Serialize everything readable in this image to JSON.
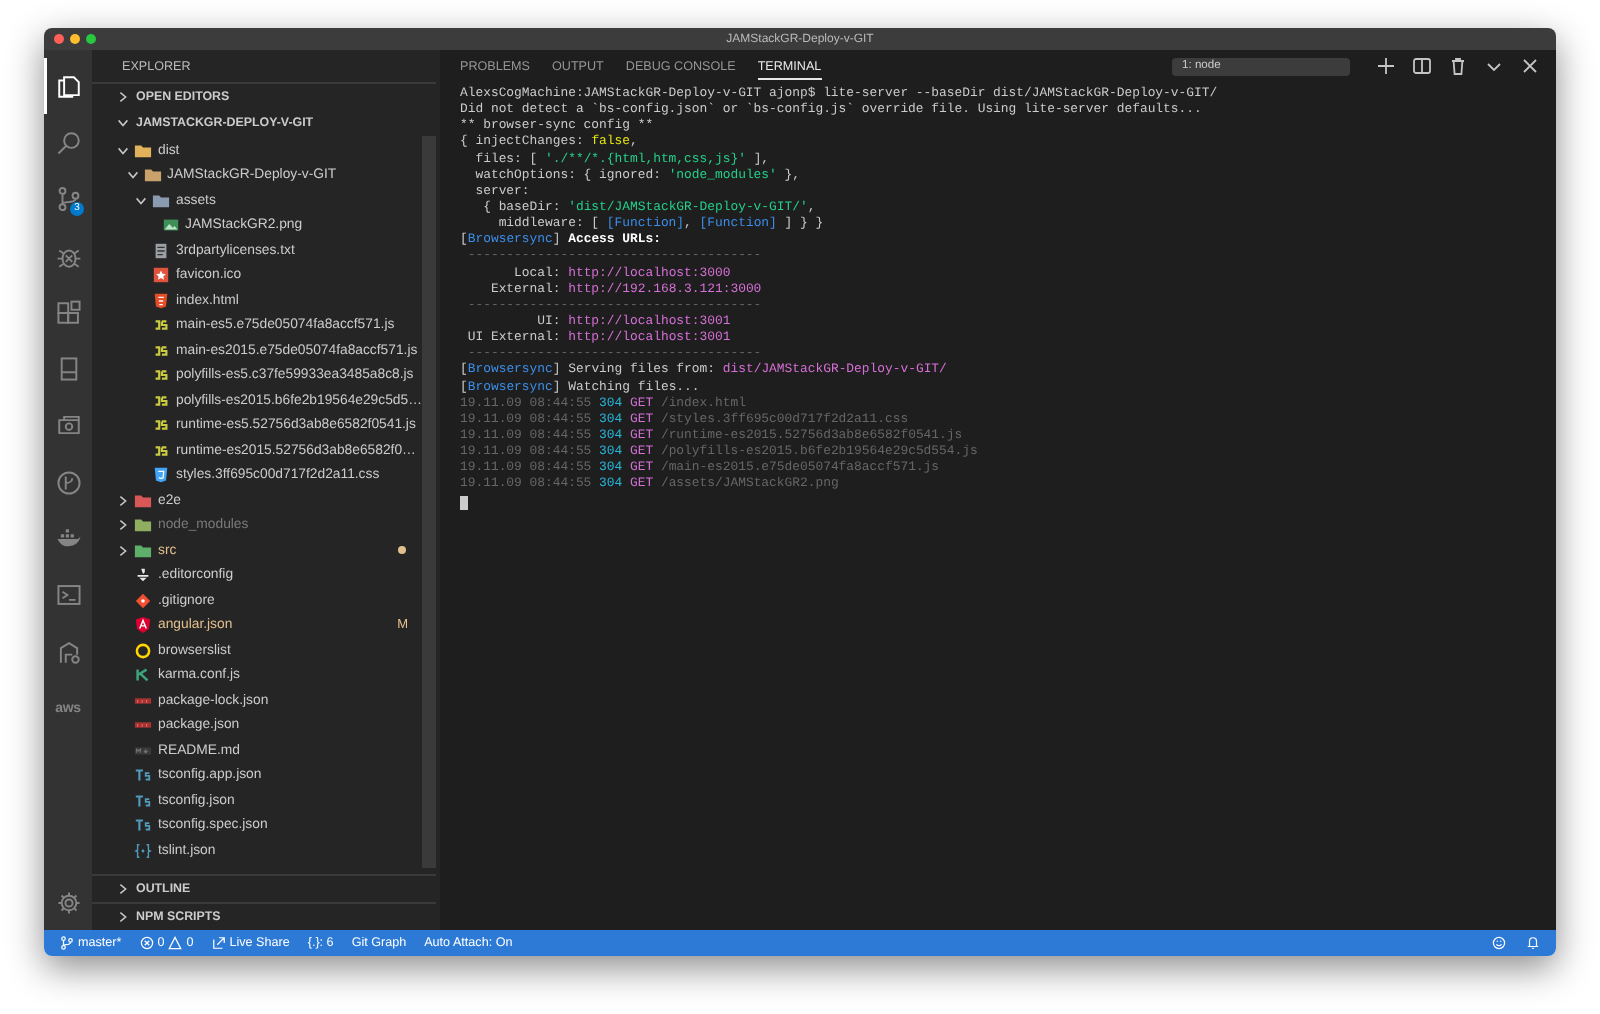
{
  "window": {
    "title": "JAMStackGR-Deploy-v-GIT"
  },
  "activity_bar": {
    "items": [
      {
        "kind": "files",
        "selected": true
      },
      {
        "kind": "search",
        "selected": false
      },
      {
        "kind": "scm",
        "selected": false,
        "badge": "3"
      },
      {
        "kind": "debug",
        "selected": false
      },
      {
        "kind": "extensions",
        "selected": false
      },
      {
        "kind": "book",
        "selected": false
      },
      {
        "kind": "remote",
        "selected": false
      },
      {
        "kind": "gitgraph",
        "selected": false
      },
      {
        "kind": "docker",
        "selected": false
      },
      {
        "kind": "terminal",
        "selected": false
      },
      {
        "kind": "azure",
        "selected": false
      },
      {
        "kind": "aws",
        "selected": false,
        "label": "aws"
      }
    ]
  },
  "sidebar": {
    "title": "EXPLORER",
    "sections": [
      {
        "label": "OPEN EDITORS",
        "expanded": false
      },
      {
        "label": "JAMSTACKGR-DEPLOY-V-GIT",
        "expanded": true
      }
    ],
    "tree": [
      {
        "name": "dist",
        "kind": "folder-dist",
        "expanded": true,
        "children": [
          {
            "name": "JAMStackGR-Deploy-v-GIT",
            "kind": "folder",
            "expanded": true,
            "children": [
              {
                "name": "assets",
                "kind": "folder-assets",
                "expanded": true,
                "children": [
                  {
                    "name": "JAMStackGR2.png",
                    "kind": "image"
                  }
                ]
              },
              {
                "name": "3rdpartylicenses.txt",
                "kind": "text"
              },
              {
                "name": "favicon.ico",
                "kind": "favicon"
              },
              {
                "name": "index.html",
                "kind": "html"
              },
              {
                "name": "main-es5.e75de05074fa8accf571.js",
                "kind": "js"
              },
              {
                "name": "main-es2015.e75de05074fa8accf571.js",
                "kind": "js"
              },
              {
                "name": "polyfills-es5.c37fe59933ea3485a8c8.js",
                "kind": "js"
              },
              {
                "name": "polyfills-es2015.b6fe2b19564e29c5d5…",
                "kind": "js"
              },
              {
                "name": "runtime-es5.52756d3ab8e6582f0541.js",
                "kind": "js"
              },
              {
                "name": "runtime-es2015.52756d3ab8e6582f0…",
                "kind": "js"
              },
              {
                "name": "styles.3ff695c00d717f2d2a11.css",
                "kind": "css"
              }
            ]
          }
        ]
      },
      {
        "name": "e2e",
        "kind": "folder-e2e",
        "expanded": false
      },
      {
        "name": "node_modules",
        "kind": "folder-node",
        "expanded": false,
        "ignored": true
      },
      {
        "name": "src",
        "kind": "folder-src",
        "expanded": false,
        "modified": true
      },
      {
        "name": ".editorconfig",
        "kind": "config"
      },
      {
        "name": ".gitignore",
        "kind": "git"
      },
      {
        "name": "angular.json",
        "kind": "angular",
        "modified": true,
        "badge": "M"
      },
      {
        "name": "browserslist",
        "kind": "browserslist"
      },
      {
        "name": "karma.conf.js",
        "kind": "karma"
      },
      {
        "name": "package-lock.json",
        "kind": "npm"
      },
      {
        "name": "package.json",
        "kind": "npm"
      },
      {
        "name": "README.md",
        "kind": "readme"
      },
      {
        "name": "tsconfig.app.json",
        "kind": "ts"
      },
      {
        "name": "tsconfig.json",
        "kind": "ts"
      },
      {
        "name": "tsconfig.spec.json",
        "kind": "ts"
      },
      {
        "name": "tslint.json",
        "kind": "tslint"
      }
    ],
    "bottom_sections": [
      {
        "label": "OUTLINE",
        "expanded": false
      },
      {
        "label": "NPM SCRIPTS",
        "expanded": false
      }
    ]
  },
  "panel": {
    "tabs": [
      {
        "label": "PROBLEMS",
        "selected": false
      },
      {
        "label": "OUTPUT",
        "selected": false
      },
      {
        "label": "DEBUG CONSOLE",
        "selected": false
      },
      {
        "label": "TERMINAL",
        "selected": true
      }
    ],
    "terminal_select": "1: node",
    "lines": [
      [
        {
          "kind": "text",
          "text": "AlexsCogMachine:JAMStackGR-Deploy-v-GIT ajonp$ lite-server --baseDir dist/JAMStackGR-Deploy-v-GIT/"
        }
      ],
      [
        {
          "kind": "text",
          "text": "Did not detect a `bs-config.json` or `bs-config.js` override file. Using lite-server defaults..."
        }
      ],
      [
        {
          "kind": "text",
          "text": "** browser-sync config **"
        }
      ],
      [
        {
          "kind": "text",
          "text": "{ injectChanges: "
        },
        {
          "kind": "yellow",
          "text": "false"
        },
        {
          "kind": "text",
          "text": ","
        }
      ],
      [
        {
          "kind": "text",
          "text": "  files: [ "
        },
        {
          "kind": "green",
          "text": "'./**/*.{html,htm,css,js}'"
        },
        {
          "kind": "text",
          "text": " ],"
        }
      ],
      [
        {
          "kind": "text",
          "text": "  watchOptions: { ignored: "
        },
        {
          "kind": "green",
          "text": "'node_modules'"
        },
        {
          "kind": "text",
          "text": " },"
        }
      ],
      [
        {
          "kind": "text",
          "text": "  server:"
        }
      ],
      [
        {
          "kind": "text",
          "text": "   { baseDir: "
        },
        {
          "kind": "green",
          "text": "'dist/JAMStackGR-Deploy-v-GIT/'"
        },
        {
          "kind": "text",
          "text": ","
        }
      ],
      [
        {
          "kind": "text",
          "text": "     middleware: [ "
        },
        {
          "kind": "blue",
          "text": "[Function]"
        },
        {
          "kind": "text",
          "text": ", "
        },
        {
          "kind": "blue",
          "text": "[Function]"
        },
        {
          "kind": "text",
          "text": " ] } }"
        }
      ],
      [
        {
          "kind": "text",
          "text": "["
        },
        {
          "kind": "blue",
          "text": "Browsersync"
        },
        {
          "kind": "text",
          "text": "] "
        },
        {
          "kind": "bold",
          "text": "Access URLs:"
        }
      ],
      [
        {
          "kind": "dim",
          "text": " --------------------------------------"
        }
      ],
      [
        {
          "kind": "text",
          "text": "       Local: "
        },
        {
          "kind": "magenta",
          "text": "http://localhost:3000"
        }
      ],
      [
        {
          "kind": "text",
          "text": "    External: "
        },
        {
          "kind": "magenta",
          "text": "http://192.168.3.121:3000"
        }
      ],
      [
        {
          "kind": "dim",
          "text": " --------------------------------------"
        }
      ],
      [
        {
          "kind": "text",
          "text": "          UI: "
        },
        {
          "kind": "magenta",
          "text": "http://localhost:3001"
        }
      ],
      [
        {
          "kind": "text",
          "text": " UI External: "
        },
        {
          "kind": "magenta",
          "text": "http://localhost:3001"
        }
      ],
      [
        {
          "kind": "dim",
          "text": " --------------------------------------"
        }
      ],
      [
        {
          "kind": "text",
          "text": "["
        },
        {
          "kind": "blue",
          "text": "Browsersync"
        },
        {
          "kind": "text",
          "text": "] Serving files from: "
        },
        {
          "kind": "magenta",
          "text": "dist/JAMStackGR-Deploy-v-GIT/"
        }
      ],
      [
        {
          "kind": "text",
          "text": "["
        },
        {
          "kind": "blue",
          "text": "Browsersync"
        },
        {
          "kind": "text",
          "text": "] Watching files..."
        }
      ],
      [
        {
          "kind": "dim",
          "text": "19.11.09 08:44:55 "
        },
        {
          "kind": "cyan",
          "text": "304"
        },
        {
          "kind": "magenta",
          "text": " GET"
        },
        {
          "kind": "dim",
          "text": " /index.html"
        }
      ],
      [
        {
          "kind": "dim",
          "text": "19.11.09 08:44:55 "
        },
        {
          "kind": "cyan",
          "text": "304"
        },
        {
          "kind": "magenta",
          "text": " GET"
        },
        {
          "kind": "dim",
          "text": " /styles.3ff695c00d717f2d2a11.css"
        }
      ],
      [
        {
          "kind": "dim",
          "text": "19.11.09 08:44:55 "
        },
        {
          "kind": "cyan",
          "text": "304"
        },
        {
          "kind": "magenta",
          "text": " GET"
        },
        {
          "kind": "dim",
          "text": " /runtime-es2015.52756d3ab8e6582f0541.js"
        }
      ],
      [
        {
          "kind": "dim",
          "text": "19.11.09 08:44:55 "
        },
        {
          "kind": "cyan",
          "text": "304"
        },
        {
          "kind": "magenta",
          "text": " GET"
        },
        {
          "kind": "dim",
          "text": " /polyfills-es2015.b6fe2b19564e29c5d554.js"
        }
      ],
      [
        {
          "kind": "dim",
          "text": "19.11.09 08:44:55 "
        },
        {
          "kind": "cyan",
          "text": "304"
        },
        {
          "kind": "magenta",
          "text": " GET"
        },
        {
          "kind": "dim",
          "text": " /main-es2015.e75de05074fa8accf571.js"
        }
      ],
      [
        {
          "kind": "dim",
          "text": "19.11.09 08:44:55 "
        },
        {
          "kind": "cyan",
          "text": "304"
        },
        {
          "kind": "magenta",
          "text": " GET"
        },
        {
          "kind": "dim",
          "text": " /assets/JAMStackGR2.png"
        }
      ]
    ]
  },
  "status_bar": {
    "items": [
      {
        "kind": "branch",
        "text": "master*"
      },
      {
        "kind": "problems",
        "errors": "0",
        "warnings": "0"
      },
      {
        "kind": "liveshare",
        "text": "Live Share"
      },
      {
        "kind": "text",
        "text": "{.}: 6"
      },
      {
        "kind": "text",
        "text": "Git Graph"
      },
      {
        "kind": "text",
        "text": "Auto Attach: On"
      }
    ]
  }
}
